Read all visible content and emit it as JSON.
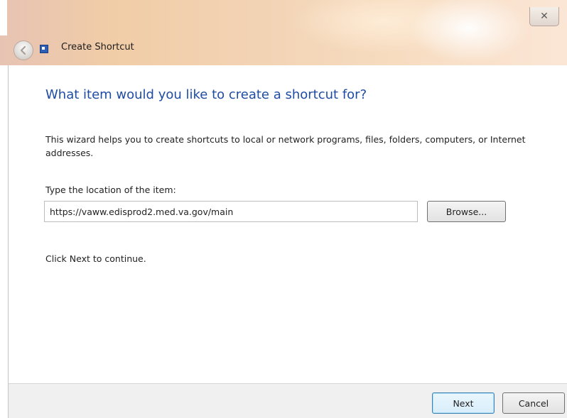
{
  "window": {
    "title": "Create Shortcut",
    "close_symbol": "✕",
    "icons": [
      "back-arrow-icon",
      "shortcut-icon",
      "close-icon"
    ]
  },
  "wizard": {
    "heading": "What item would you like to create a shortcut for?",
    "description": "This wizard helps you to create shortcuts to local or network programs, files, folders, computers, or Internet addresses.",
    "location_label": "Type the location of the item:",
    "location_value": "https://vaww.edisprod2.med.va.gov/main",
    "browse_label": "Browse...",
    "continue_note": "Click Next to continue."
  },
  "footer": {
    "next_label": "Next",
    "cancel_label": "Cancel"
  },
  "colors": {
    "heading": "#1f4ca3",
    "title_gradient_start": "#e7c3b4",
    "title_gradient_end": "#fbe6d6"
  }
}
